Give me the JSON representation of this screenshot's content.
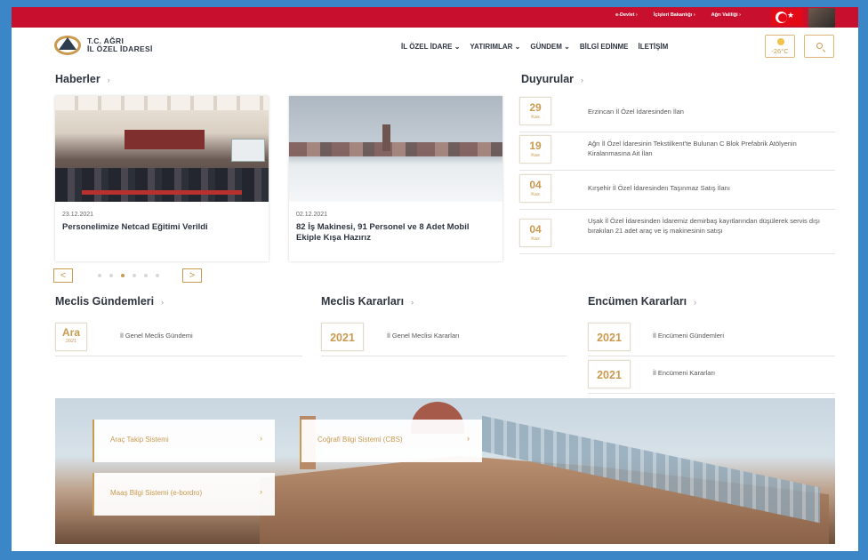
{
  "topbar": {
    "links": [
      "e-Devlet",
      "İçişleri Bakanlığı",
      "Ağrı Valiliği"
    ],
    "link_arrow": "›"
  },
  "header": {
    "logo_line1": "T.C. AĞRI",
    "logo_line2": "İL ÖZEL İDARESİ",
    "nav": [
      "İL ÖZEL İDARE ⌄",
      "YATIRIMLAR ⌄",
      "GÜNDEM ⌄",
      "BİLGİ EDİNME",
      "İLETİŞİM"
    ],
    "temperature": "-26°C"
  },
  "news": {
    "title": "Haberler",
    "arrow": "›",
    "cards": [
      {
        "date": "23.12.2021",
        "title": "Personelimize Netcad Eğitimi Verildi"
      },
      {
        "date": "02.12.2021",
        "title": "82 İş Makinesi, 91 Personel ve 8 Adet Mobil Ekiple Kışa Hazırız"
      }
    ],
    "prev": "<",
    "next": ">"
  },
  "announcements": {
    "title": "Duyurular",
    "arrow": "›",
    "items": [
      {
        "day": "29",
        "month": "Kas",
        "text": "Erzincan İl Özel İdaresinden İlan"
      },
      {
        "day": "19",
        "month": "Kas",
        "text": "Ağrı İl Özel İdaresinin Tekstilkent'te Bulunan C Blok Prefabrik Atölyenin Kiralanmasına Ait İlan"
      },
      {
        "day": "04",
        "month": "Kas",
        "text": "Kırşehir İl Özel İdaresinden Taşınmaz Satış İlanı"
      },
      {
        "day": "04",
        "month": "Kas",
        "text": "Uşak İl Özel İdaresinden İdaremiz demirbaş kayıtlarından düşülerek servis dışı bırakılan 21 adet araç ve iş makinesinin satışı"
      }
    ]
  },
  "meclis_gundem": {
    "title": "Meclis Gündemleri",
    "arrow": "›",
    "items": [
      {
        "big": "Ara",
        "small": "2021",
        "label": "İl Genel Meclis Gündemi"
      }
    ]
  },
  "meclis_karar": {
    "title": "Meclis Kararları",
    "arrow": "›",
    "items": [
      {
        "big": "2021",
        "label": "İl Genel Meclisi Kararları"
      }
    ]
  },
  "encumen": {
    "title": "Encümen Kararları",
    "arrow": "›",
    "items": [
      {
        "big": "2021",
        "label": "İl Encümeni Gündemleri"
      },
      {
        "big": "2021",
        "label": "İl Encümeni Kararları"
      }
    ]
  },
  "banner": {
    "cards": [
      {
        "label": "Araç Takip Sistemi",
        "arrow": "›"
      },
      {
        "label": "Coğrafi Bilgi Sistemi (CBS)",
        "arrow": "›"
      },
      {
        "label": "Maaş Bilgi Sistemi (e-bordro)",
        "arrow": "›"
      }
    ]
  },
  "colors": {
    "brand_red": "#c8102e",
    "accent_gold": "#c99a4f",
    "text_dark": "#2e3540",
    "frame_blue": "#3b86c6"
  },
  "icons": [
    "search-icon",
    "sun-icon",
    "turkish-flag-icon",
    "chevron-right-icon"
  ]
}
